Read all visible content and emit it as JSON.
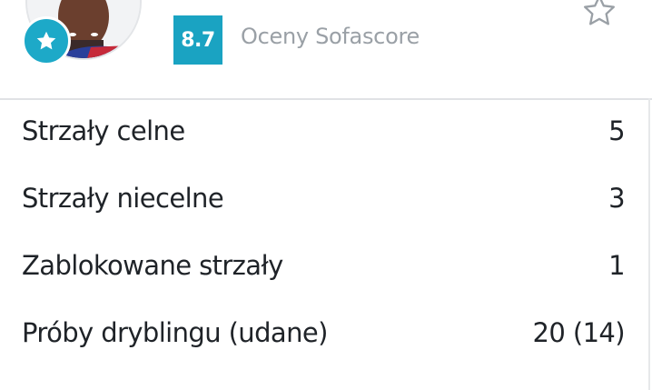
{
  "header": {
    "rating": "8.7",
    "rating_label": "Oceny Sofascore",
    "colors": {
      "accent": "#1aa3c2",
      "badge": "#1da9c8",
      "muted_text": "#9aa0a6",
      "text": "#1f2328"
    },
    "icons": {
      "badge": "star-icon",
      "favorite": "star-outline-icon"
    }
  },
  "stats": [
    {
      "label": "Strzały celne",
      "value": "5"
    },
    {
      "label": "Strzały niecelne",
      "value": "3"
    },
    {
      "label": "Zablokowane strzały",
      "value": "1"
    },
    {
      "label": "Próby dryblingu (udane)",
      "value": "20 (14)"
    }
  ]
}
